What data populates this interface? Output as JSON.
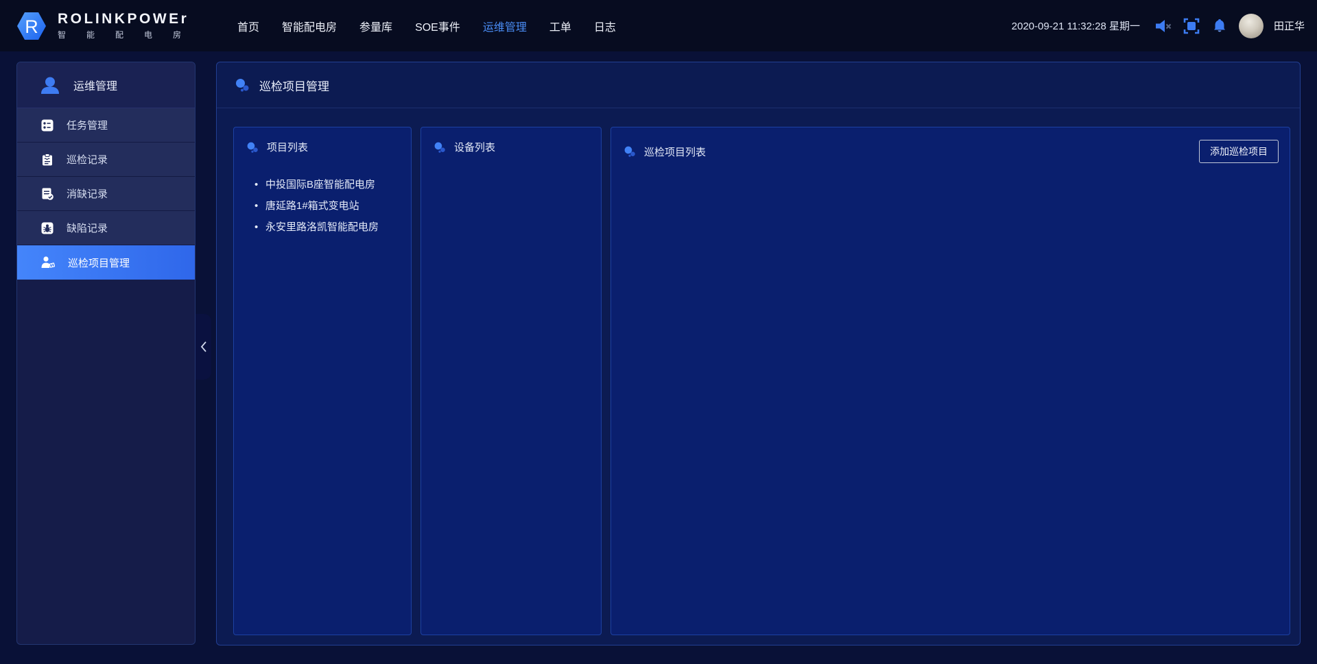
{
  "topbar": {
    "brand": {
      "logo_letter": "R",
      "name": "ROLINKPOWEr",
      "subtitle": "智能配电房"
    },
    "nav": [
      {
        "label": "首页",
        "active": false
      },
      {
        "label": "智能配电房",
        "active": false
      },
      {
        "label": "参量库",
        "active": false
      },
      {
        "label": "SOE事件",
        "active": false
      },
      {
        "label": "运维管理",
        "active": true
      },
      {
        "label": "工单",
        "active": false
      },
      {
        "label": "日志",
        "active": false
      }
    ],
    "datetime": "2020-09-21 11:32:28 星期一",
    "icons": [
      "speaker-muted",
      "fullscreen",
      "bell"
    ],
    "user": {
      "name": "田正华"
    }
  },
  "sidebar": {
    "header": {
      "label": "运维管理",
      "icon": "user-icon"
    },
    "items": [
      {
        "label": "任务管理",
        "icon": "task-icon",
        "active": false
      },
      {
        "label": "巡检记录",
        "icon": "inspection-record-icon",
        "active": false
      },
      {
        "label": "消缺记录",
        "icon": "defect-clear-icon",
        "active": false
      },
      {
        "label": "缺陷记录",
        "icon": "defect-record-icon",
        "active": false
      },
      {
        "label": "巡检项目管理",
        "icon": "inspection-project-icon",
        "active": true
      }
    ],
    "collapse_chevron": "left"
  },
  "main": {
    "page_title": "巡检项目管理",
    "panels": [
      {
        "title": "项目列表",
        "items": [
          "中投国际B座智能配电房",
          "唐延路1#箱式变电站",
          "永安里路洛凯智能配电房"
        ]
      },
      {
        "title": "设备列表",
        "items": []
      },
      {
        "title": "巡检项目列表",
        "items": [],
        "action_button": "添加巡检项目"
      }
    ]
  },
  "colors": {
    "accent_blue": "#3d7cf2",
    "nav_active": "#4a8df5",
    "sidebar_active_gradient": [
      "#4485fb",
      "#2f67ea"
    ],
    "panel_bg": "#0a1f6e",
    "panel_border": "#1d41a2",
    "wrapper_bg": "#0c1b52",
    "sidebar_bg": "#151c49",
    "sidebar_item_bg": "#232d5c",
    "topbar_bg": "#070c20",
    "page_bg": "#091137"
  }
}
